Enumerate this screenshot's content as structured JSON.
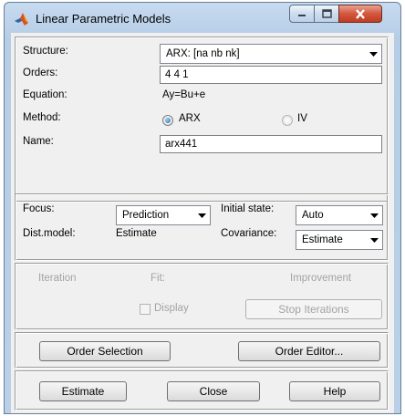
{
  "window": {
    "title": "Linear Parametric Models"
  },
  "model": {
    "structure_label": "Structure:",
    "structure_value": "ARX: [na nb nk]",
    "orders_label": "Orders:",
    "orders_value": "4 4 1",
    "equation_label": "Equation:",
    "equation_value": "Ay=Bu+e",
    "method_label": "Method:",
    "method_options": [
      {
        "label": "ARX",
        "selected": true
      },
      {
        "label": "IV",
        "selected": false
      }
    ],
    "name_label": "Name:",
    "name_value": "arx441"
  },
  "settings": {
    "focus_label": "Focus:",
    "focus_value": "Prediction",
    "initial_state_label": "Initial state:",
    "initial_state_value": "Auto",
    "dist_model_label": "Dist.model:",
    "dist_model_value": "Estimate",
    "covariance_label": "Covariance:",
    "covariance_value": "Estimate"
  },
  "iteration": {
    "iteration_label": "Iteration",
    "fit_label": "Fit:",
    "improvement_label": "Improvement",
    "display_label": "Display",
    "stop_label": "Stop Iterations"
  },
  "order_buttons": {
    "order_selection": "Order Selection",
    "order_editor": "Order Editor..."
  },
  "actions": {
    "estimate": "Estimate",
    "close": "Close",
    "help": "Help"
  }
}
